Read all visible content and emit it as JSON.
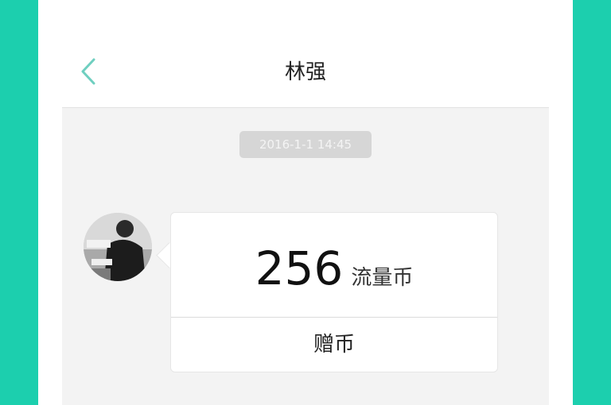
{
  "header": {
    "title": "林强",
    "back_icon": "chevron-left-icon",
    "accent_color": "#1ccfae"
  },
  "chat": {
    "timestamp": "2016-1-1  14:45",
    "message": {
      "amount": "256",
      "unit": "流量币",
      "action_label": "赠币"
    }
  }
}
